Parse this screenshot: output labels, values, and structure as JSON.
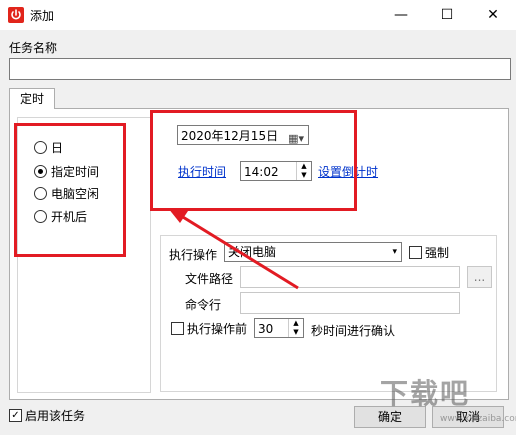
{
  "window": {
    "title": "添加",
    "minimize": "—",
    "maximize": "☐",
    "close": "✕"
  },
  "task_name": {
    "label": "任务名称",
    "value": ""
  },
  "tab": {
    "label": "定时"
  },
  "schedule_options": [
    {
      "label": "日",
      "selected": false
    },
    {
      "label": "指定时间",
      "selected": true
    },
    {
      "label": "电脑空闲",
      "selected": false
    },
    {
      "label": "开机后",
      "selected": false
    }
  ],
  "date_picker": {
    "value": "2020年12月15日"
  },
  "exec_time": {
    "link_label": "执行时间",
    "value": "14:02",
    "countdown_link": "设置倒计时"
  },
  "action": {
    "label": "执行操作",
    "selected": "关闭电脑",
    "force_label": "强制",
    "file_path_label": "文件路径",
    "file_path_value": "",
    "browse_label": "...",
    "command_label": "命令行",
    "command_value": "",
    "confirm_before_label": "执行操作前",
    "confirm_seconds": "30",
    "confirm_suffix": "秒时间进行确认"
  },
  "footer": {
    "enable_label": "启用该任务",
    "enabled": true,
    "ok_label": "确定",
    "cancel_label": "取消"
  },
  "watermark": {
    "text": "下载吧",
    "sub": "www.xiazaiba.com"
  },
  "colors": {
    "highlight": "#e21b23",
    "link": "#0033cc"
  }
}
